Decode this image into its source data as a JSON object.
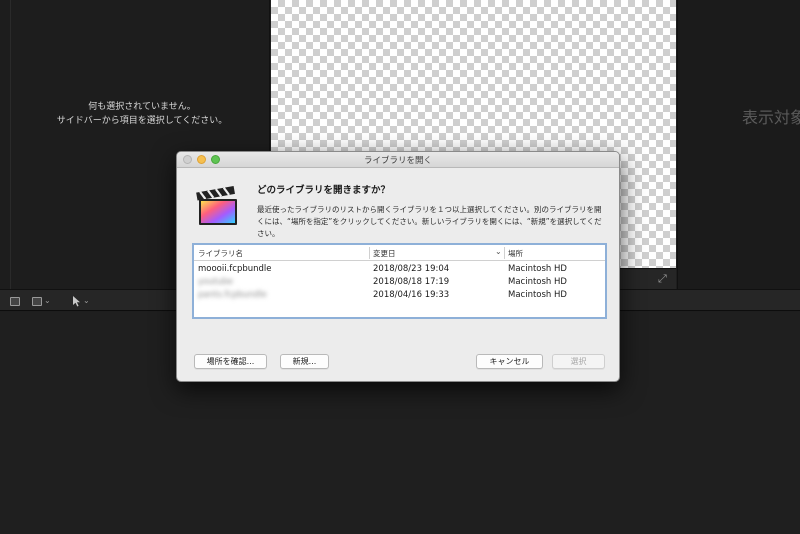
{
  "browser": {
    "empty_line1": "何も選択されていません。",
    "empty_line2": "サイドバーから項目を選択してください。"
  },
  "inspector": {
    "empty_text": "表示対象"
  },
  "dialog": {
    "title": "ライブラリを開く",
    "heading": "どのライブラリを開きますか？",
    "body": "最近使ったライブラリのリストから開くライブラリを１つ以上選択してください。別のライブラリを開くには、“場所を指定”をクリックしてください。新しいライブラリを開くには、“新規”を選択してください。",
    "table": {
      "columns": [
        "ライブラリ名",
        "変更日",
        "場所"
      ],
      "rows": [
        {
          "name": "moooii.fcpbundle",
          "date": "2018/08/23 19:04",
          "location": "Macintosh HD",
          "blurred": false
        },
        {
          "name": "youtube",
          "date": "2018/08/18 17:19",
          "location": "Macintosh HD",
          "blurred": true
        },
        {
          "name": "pants.fcpbundle",
          "date": "2018/04/16 19:33",
          "location": "Macintosh HD",
          "blurred": true
        }
      ]
    },
    "buttons": {
      "locate": "場所を確認...",
      "new": "新規...",
      "cancel": "キャンセル",
      "choose": "選択"
    }
  },
  "colors": {
    "accent_close": "#d0d0d0",
    "accent_min": "#f5bf4f",
    "accent_max": "#5fc453",
    "table_focus": "#8eb0d8"
  },
  "icons": [
    "final-cut-pro-icon",
    "fullscreen-icon",
    "clip-appearance-icon",
    "select-tool-icon",
    "sort-desc-icon"
  ]
}
